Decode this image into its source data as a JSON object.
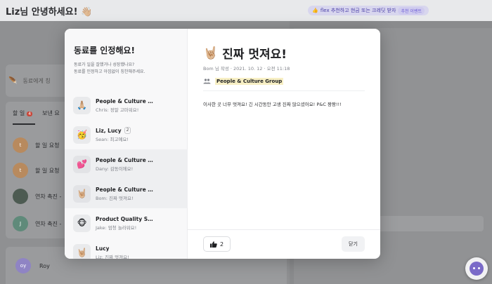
{
  "background": {
    "greeting": "Liz님 안녕하세요! 👋🏼",
    "promo": "flex 추천하고 현금 또는 크레딧 받자",
    "promo_tag": "추천 이벤트",
    "search_placeholder": "동료에게 칭",
    "tabs": [
      {
        "label": "할 일",
        "badge": "4"
      },
      {
        "label": "보낸 요"
      }
    ],
    "rows": [
      {
        "avatar": "t",
        "text": "할 일 요청"
      },
      {
        "avatar": "t",
        "text": "할 일 요청"
      },
      {
        "avatar": "",
        "text": "연차 촉진 -"
      },
      {
        "avatar": "J",
        "text": "연차 촉진 -"
      }
    ],
    "roy": {
      "avatar": "oy",
      "name": "Roy"
    }
  },
  "modal": {
    "left": {
      "title": "동료를 인정해요!",
      "description_line1": "동료가 일을 잘했거나 성장했나요?",
      "description_line2": "동료를 인정하고 아낌없이 칭찬해주세요.",
      "items": [
        {
          "emoji": "🙏🏼",
          "name": "People & Culture ...",
          "count": "",
          "sub": "Chris: 정말 고마워요!"
        },
        {
          "emoji": "🥳",
          "name": "Liz, Lucy",
          "count": "2",
          "sub": "Sean: 최고예요!"
        },
        {
          "emoji": "💕",
          "name": "People & Culture ...",
          "count": "",
          "sub": "Dany: 감동이에요!"
        },
        {
          "emoji": "🤘🏼",
          "name": "People & Culture ...",
          "count": "",
          "sub": "Bom: 진짜 멋져요!"
        },
        {
          "emoji": "🐵",
          "name": "Product Quality Sq...",
          "count": "",
          "sub": "Jake: 엄청 놀라워요!"
        },
        {
          "emoji": "🤘🏼",
          "name": "Lucy",
          "count": "",
          "sub": "Liz: 진짜 멋져요!"
        }
      ]
    },
    "right": {
      "emoji": "🤘🏼",
      "title": "진짜 멋져요!",
      "meta": "Bom 님 작성 · 2021. 10. 12 · 오전 11:18",
      "group": "People & Culture Group",
      "body": "이사한 곳 너무 멋져요! 긴 시간동안 고생 진짜 많으셨어요! P&C 짱짱!!!",
      "likes": "2",
      "close_label": "닫기"
    }
  }
}
